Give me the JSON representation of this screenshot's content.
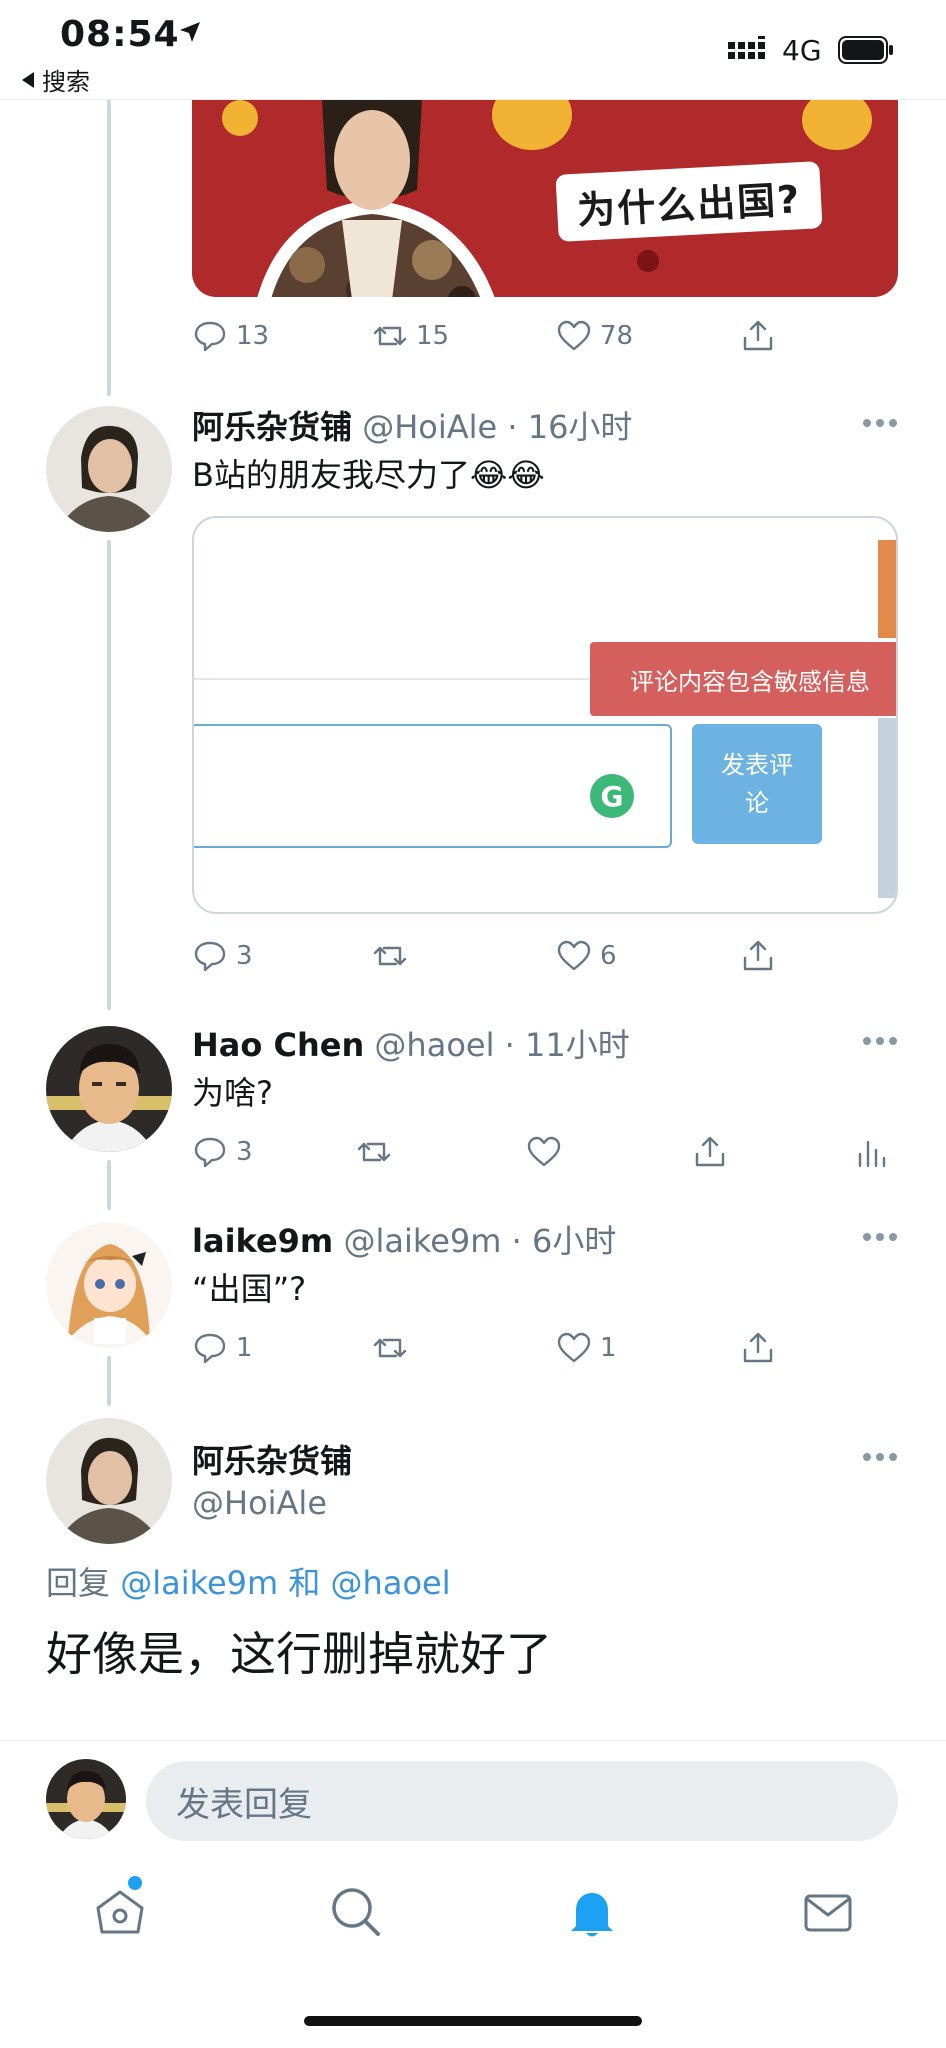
{
  "status_bar": {
    "time": "08:54",
    "back_label": "搜索",
    "network": "4G"
  },
  "media_top": {
    "caption": "为什么出国?",
    "colors": {
      "background": "#b02a2c"
    }
  },
  "tweets": [
    {
      "actions": {
        "reply_count": "13",
        "retweet_count": "15",
        "like_count": "78"
      }
    },
    {
      "name": "阿乐杂货铺",
      "meta": "@HoiAle · 16小时",
      "text": "B站的朋友我尽力了😂😂",
      "embed": {
        "warning": "评论内容包含敏感信息",
        "submit_label": "发表评论",
        "grammarly_badge": "G"
      },
      "actions": {
        "reply_count": "3",
        "retweet_count": "",
        "like_count": "6"
      }
    },
    {
      "name": "Hao Chen",
      "meta": "@haoel · 11小时",
      "text": "为啥?",
      "actions": {
        "reply_count": "3",
        "retweet_count": "",
        "like_count": ""
      }
    },
    {
      "name": "laike9m",
      "meta": "@laike9m · 6小时",
      "text": "“出国”?",
      "actions": {
        "reply_count": "1",
        "retweet_count": "",
        "like_count": "1"
      }
    }
  ],
  "main_tweet": {
    "name": "阿乐杂货铺",
    "handle": "@HoiAle",
    "reply_prefix": "回复",
    "mention_1": "@laike9m",
    "reply_join": "和",
    "mention_2": "@haoel",
    "text": "好像是，这行删掉就好了"
  },
  "composer": {
    "placeholder": "发表回复"
  },
  "tabbar": {
    "items": [
      "home-icon",
      "search-icon",
      "bell-icon",
      "mail-icon"
    ],
    "active": "bell-icon",
    "colors": {
      "active": "#1da1f2",
      "inactive": "#657786"
    }
  }
}
